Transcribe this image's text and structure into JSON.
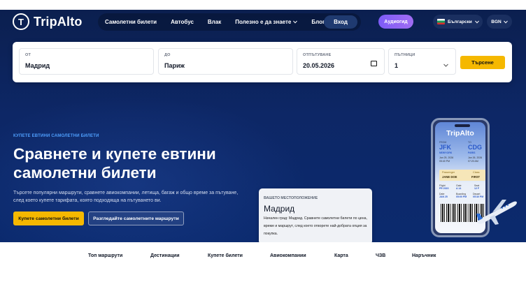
{
  "header": {
    "logo_letter": "T",
    "brand": "TripAlto",
    "nav": [
      {
        "label": "Самолетни билети"
      },
      {
        "label": "Автобус"
      },
      {
        "label": "Влак"
      },
      {
        "label": "Полезно е да знаете"
      },
      {
        "label": "Блог"
      }
    ],
    "login": "Вход",
    "audio": "Аудиогид",
    "language": "Български",
    "currency": "BGN"
  },
  "search": {
    "from_label": "ОТ",
    "from_value": "Мадрид",
    "to_label": "ДО",
    "to_value": "Париж",
    "date_label": "ОТПЪТУВАНЕ",
    "date_value": "20.05.2026",
    "pax_label": "ПЪТНИЦИ",
    "pax_value": "1",
    "submit": "Търсене"
  },
  "hero": {
    "eyebrow": "КУПЕТЕ ЕВТИНИ САМОЛЕТНИ БИЛЕТИ",
    "headline": "Сравнете и купете евтини самолетни билети",
    "subtext": "Търсете популярни маршрути, сравнете авиокомпании, летища, багаж и общо време за пътуване, след което купете тарифата, която подходяща на пътуването ви.",
    "primary_btn": "Купете самолетни билети",
    "secondary_btn": "Разгледайте самолетните маршрути"
  },
  "location": {
    "label": "ВАШЕТО МЕСТОПОЛОЖЕНИЕ",
    "city": "Мадрид",
    "desc": "Начален град: Мадрид. Сравнете самолетни билети по цена, време и маршрут, след което отворете най-добрата опция за покупка."
  },
  "phone": {
    "title": "TripAlto",
    "from_label": "FROM",
    "to_label": "TO",
    "from_code": "JFK",
    "to_code": "CDG",
    "from_city": "NEWYORK",
    "to_city": "PARIS",
    "from_time": "Jan 25, 2026\n05:40 PM",
    "to_time": "Jan 26, 2026\n07:20 AM",
    "passenger_label": "Passenger",
    "passenger": "JANE DOE",
    "class_label": "Class",
    "class": "FIRST",
    "flight_label": "Flight",
    "flight": "FR 2023",
    "gate_label": "Gate",
    "gate": "A 14",
    "seat_label": "Seat",
    "seat": "12 F",
    "date_label": "Date",
    "date": "JAN 25",
    "boarding_label": "Boarding",
    "boarding": "05:00 PM",
    "depart_label": "Depart",
    "depart": "05:40 PM"
  },
  "bottom_nav": [
    {
      "label": "Топ маршрути"
    },
    {
      "label": "Дестинации"
    },
    {
      "label": "Купете билети"
    },
    {
      "label": "Авиокомпании"
    },
    {
      "label": "Карта"
    },
    {
      "label": "ЧЗВ"
    },
    {
      "label": "Наръчник"
    }
  ],
  "icons": {
    "calendar": "calendar-icon",
    "chevron": "chevron-down-icon",
    "flag": "bulgaria-flag-icon",
    "plane": "airplane-icon"
  },
  "colors": {
    "accent": "#f5b800",
    "hero_bg": "#0d2766",
    "audio": "#8b64f5"
  }
}
